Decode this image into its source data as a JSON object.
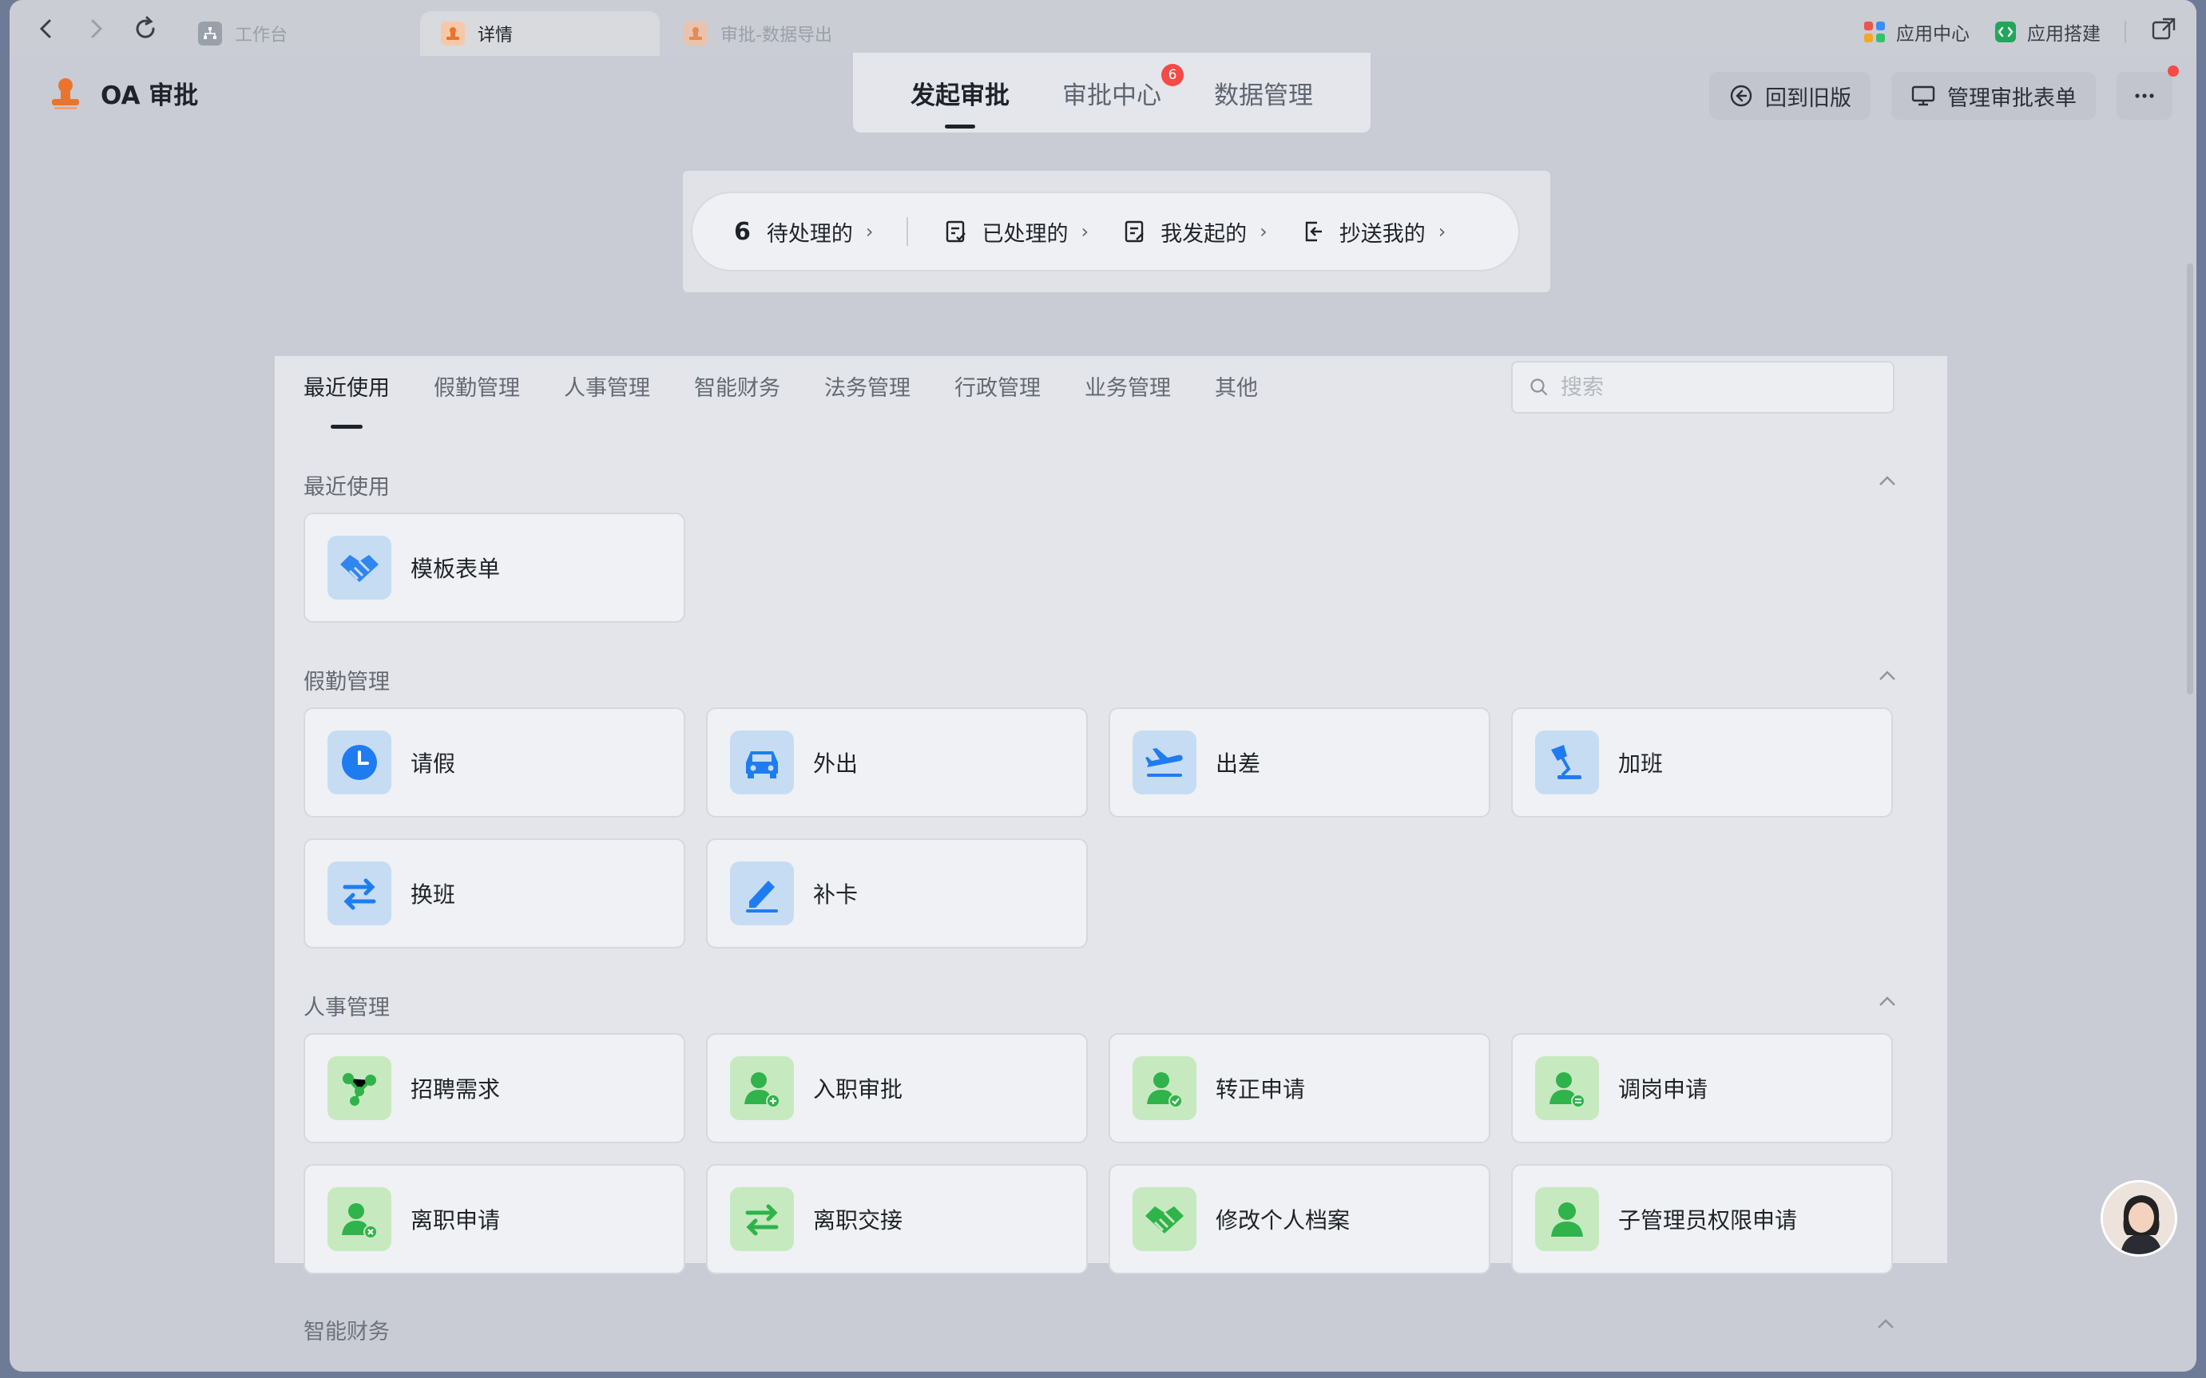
{
  "browser": {
    "tabs": [
      {
        "label": "工作台",
        "active": false
      },
      {
        "label": "详情",
        "active": true
      },
      {
        "label": "审批-数据导出",
        "active": false
      }
    ],
    "links": {
      "app_center": "应用中心",
      "app_builder": "应用搭建"
    }
  },
  "header": {
    "app_title": "OA 审批",
    "tabs": [
      {
        "label": "发起审批",
        "active": true
      },
      {
        "label": "审批中心",
        "badge": "6"
      },
      {
        "label": "数据管理"
      }
    ],
    "back_old_label": "回到旧版",
    "manage_forms_label": "管理审批表单"
  },
  "stats": {
    "pending_count": "6",
    "pending_label": "待处理的",
    "processed_label": "已处理的",
    "initiated_label": "我发起的",
    "cc_label": "抄送我的"
  },
  "categories": {
    "tabs": [
      "最近使用",
      "假勤管理",
      "人事管理",
      "智能财务",
      "法务管理",
      "行政管理",
      "业务管理",
      "其他"
    ],
    "search_placeholder": "搜索"
  },
  "sections": {
    "recent": {
      "title": "最近使用",
      "items": [
        "模板表单"
      ]
    },
    "attendance": {
      "title": "假勤管理",
      "items": [
        "请假",
        "外出",
        "出差",
        "加班",
        "换班",
        "补卡"
      ]
    },
    "hr": {
      "title": "人事管理",
      "items": [
        "招聘需求",
        "入职审批",
        "转正申请",
        "调岗申请",
        "离职申请",
        "离职交接",
        "修改个人档案",
        "子管理员权限申请"
      ]
    },
    "finance": {
      "title": "智能财务"
    }
  },
  "colors": {
    "accent_blue": "#1f7cf0",
    "accent_green": "#2fb34a",
    "badge_red": "#f54a45"
  }
}
